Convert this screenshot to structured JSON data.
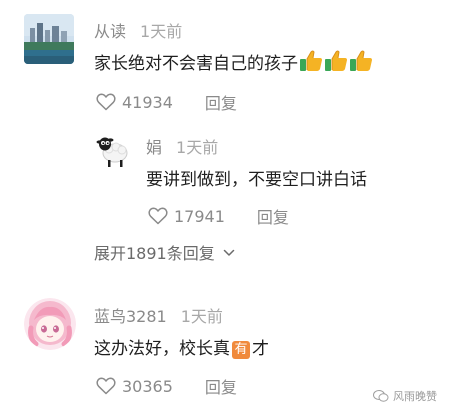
{
  "comments": [
    {
      "user": "从读",
      "time": "1天前",
      "text": "家长绝对不会害自己的孩子",
      "emoji_count": 3,
      "emoji": "thumbs-up-icon",
      "likes": "41934",
      "reply_label": "回复"
    },
    {
      "user": "娟",
      "time": "1天前",
      "text": "要讲到做到，不要空口讲白话",
      "likes": "17941",
      "reply_label": "回复"
    },
    {
      "user": "蓝鸟3281",
      "time": "1天前",
      "text_before": "这办法好，校长真",
      "badge": "有",
      "text_after": "才",
      "likes": "30365",
      "reply_label": "回复"
    }
  ],
  "expand_label": "展开1891条回复",
  "watermark": "风雨晚赞",
  "colors": {
    "text": "#1f1f1f",
    "meta": "#8a8a8a",
    "badge": "#f08a3c"
  }
}
